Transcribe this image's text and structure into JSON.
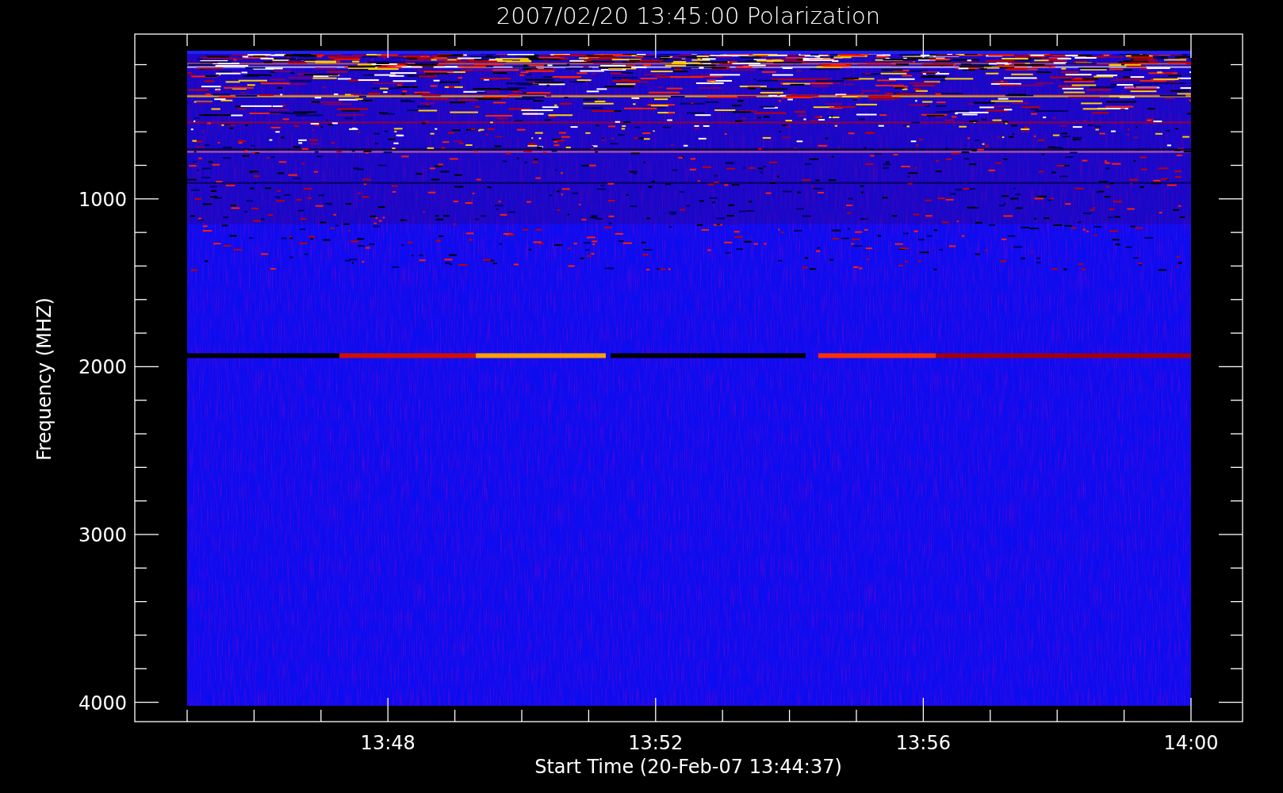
{
  "chart": {
    "title": "2007/02/20 13:45:00 Polarization",
    "xlabel": "Start Time (20-Feb-07 13:44:37)",
    "ylabel": "Frequency (MHZ)",
    "xticks": [
      "13:48",
      "13:52",
      "13:56",
      "14:00"
    ],
    "yticks": [
      "1000",
      "2000",
      "3000",
      "4000"
    ]
  }
}
